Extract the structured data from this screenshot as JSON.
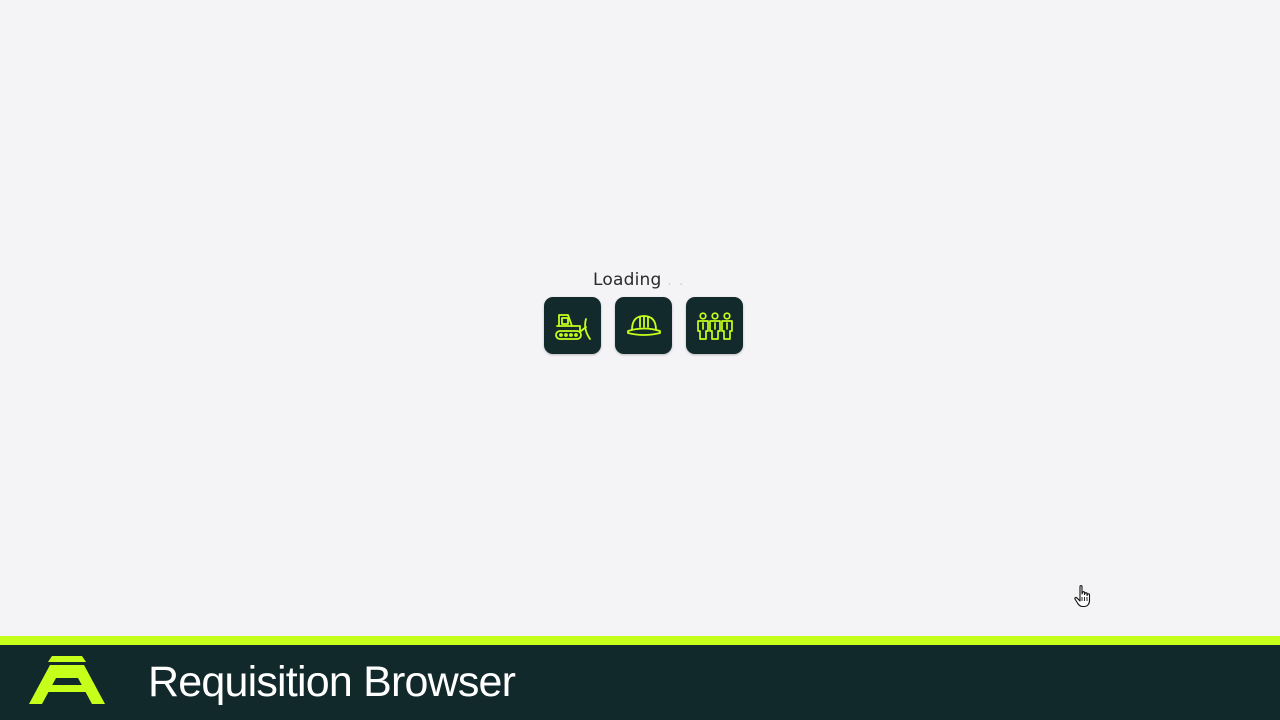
{
  "loader": {
    "label": "Loading",
    "dots": ". .",
    "icons": [
      "bulldozer-icon",
      "hard-hat-icon",
      "team-icon"
    ]
  },
  "footer": {
    "title": "Requisition Browser",
    "logo": "brand-logo-icon"
  },
  "colors": {
    "background": "#f4f3f6",
    "tile": "#132a2c",
    "accent": "#c6ff1a",
    "footer": "#12292b",
    "title": "#ffffff"
  }
}
